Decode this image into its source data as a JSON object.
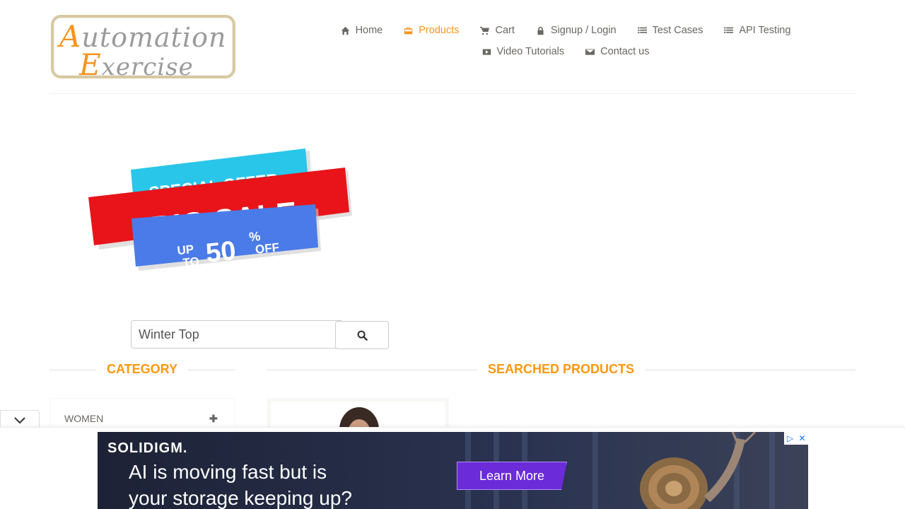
{
  "logo": {
    "line1_cap": "A",
    "line1_rest": "utomation",
    "line2_cap": "E",
    "line2_rest": "xercise"
  },
  "nav": {
    "items": [
      {
        "label": "Home",
        "icon": "home-icon",
        "active": false
      },
      {
        "label": "Products",
        "icon": "briefcase-icon",
        "active": true
      },
      {
        "label": "Cart",
        "icon": "cart-icon",
        "active": false
      },
      {
        "label": "Signup / Login",
        "icon": "lock-icon",
        "active": false
      },
      {
        "label": "Test Cases",
        "icon": "list-icon",
        "active": false
      },
      {
        "label": "API Testing",
        "icon": "list-icon",
        "active": false
      },
      {
        "label": "Video Tutorials",
        "icon": "youtube-play-icon",
        "active": false
      },
      {
        "label": "Contact us",
        "icon": "envelope-icon",
        "active": false
      }
    ]
  },
  "banner": {
    "line1": "SPECIAL OFFER",
    "line2": "BIG SALE",
    "line3_a": "UP",
    "line3_b": "TO",
    "line3_c": "50",
    "line3_d": "%",
    "line3_e": "OFF"
  },
  "search": {
    "value": "Winter Top",
    "button_icon": "search-icon"
  },
  "category": {
    "title": "CATEGORY",
    "items": [
      {
        "label": "WOMEN"
      }
    ]
  },
  "products": {
    "title": "SEARCHED PRODUCTS"
  },
  "ad": {
    "brand": "SOLIDIGM.",
    "text_line1": "AI is moving fast but is",
    "text_line2": "your storage keeping up?",
    "cta": "Learn More"
  },
  "colors": {
    "accent": "#fe980f",
    "nav_active": "#f7941d",
    "text": "#696763"
  }
}
